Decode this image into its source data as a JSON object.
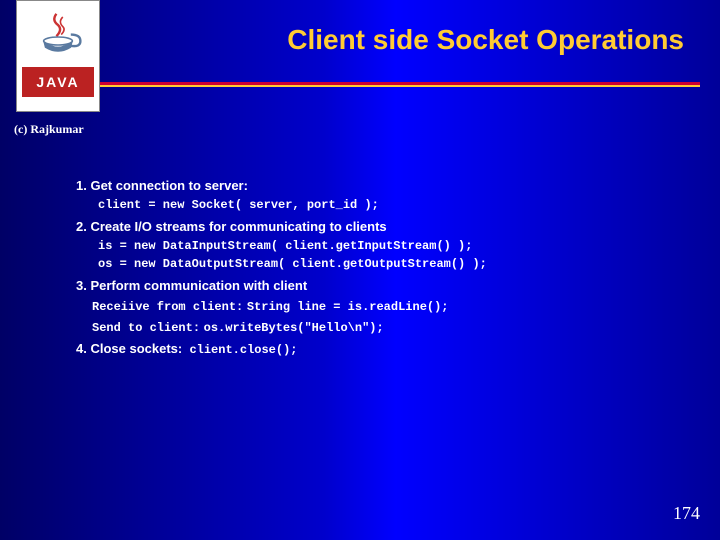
{
  "logo": {
    "label": "JAVA"
  },
  "title": "Client side Socket Operations",
  "copyright": "(c) Rajkumar",
  "steps": [
    {
      "heading": "1. Get connection to server:",
      "lines": [
        {
          "code": "client = new Socket( server, port_id );"
        }
      ]
    },
    {
      "heading": "2. Create I/O streams for communicating to clients",
      "lines": [
        {
          "code": "is = new DataInputStream( client.getInputStream() );"
        },
        {
          "code": "os = new DataOutputStream( client.getOutputStream() );"
        }
      ]
    },
    {
      "heading": "3. Perform communication with client",
      "lines": [
        {
          "prefix": "Receiive from client:",
          "code": "String line = is.readLine();"
        },
        {
          "prefix": "Send to client:",
          "code": "os.writeBytes(\"Hello\\n\");"
        }
      ]
    },
    {
      "heading": "4. Close sockets:",
      "inline_code": "client.close();"
    }
  ],
  "page_number": "174"
}
